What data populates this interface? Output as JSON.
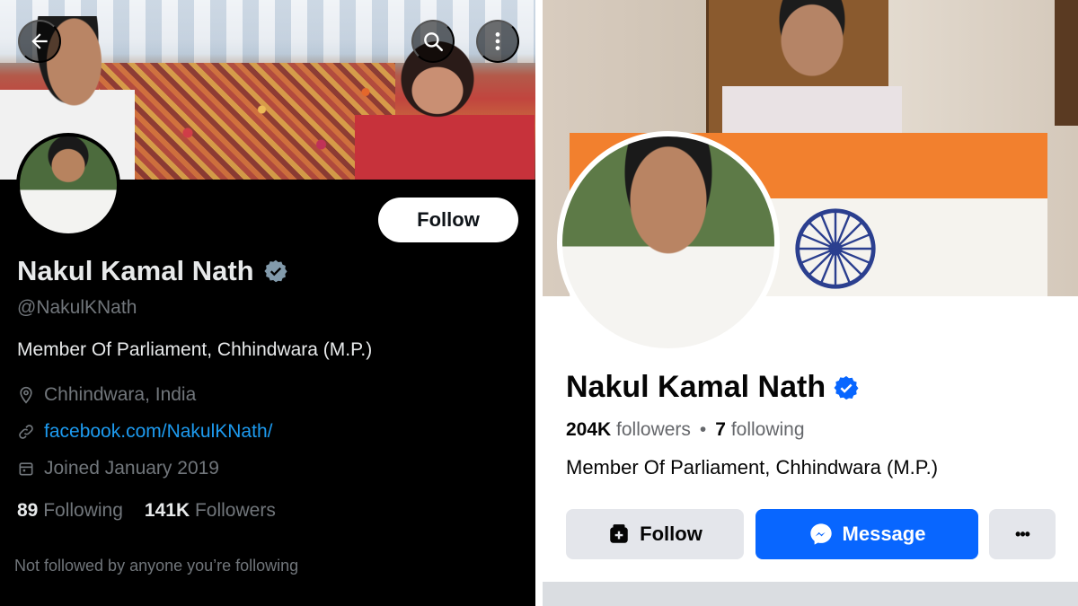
{
  "twitter": {
    "name": "Nakul Kamal Nath",
    "handle": "@NakulKNath",
    "bio": "Member Of Parliament, Chhindwara (M.P.)",
    "location": "Chhindwara, India",
    "link": "facebook.com/NakulKNath/",
    "joined": "Joined January 2019",
    "following_count": "89",
    "following_label": "Following",
    "followers_count": "141K",
    "followers_label": "Followers",
    "follow_button": "Follow",
    "note": "Not followed by anyone you’re following",
    "icons": [
      "back-arrow-icon",
      "search-icon",
      "more-vertical-icon",
      "verified-badge-icon",
      "location-pin-icon",
      "link-icon",
      "calendar-icon"
    ],
    "colors": {
      "background": "#000000",
      "text": "#e7e9ea",
      "muted": "#71767b",
      "link": "#1d9bf0",
      "verified": "#829aab"
    }
  },
  "facebook": {
    "name": "Nakul Kamal Nath",
    "followers_count": "204K",
    "followers_label": "followers",
    "separator": "•",
    "following_count": "7",
    "following_label": "following",
    "bio": "Member Of Parliament, Chhindwara (M.P.)",
    "follow_button": "Follow",
    "message_button": "Message",
    "more_button": "•••",
    "icons": [
      "verified-badge-icon",
      "follow-user-icon",
      "messenger-icon",
      "more-horizontal-icon"
    ],
    "colors": {
      "primary": "#0866ff",
      "secondary_button": "#e4e6eb",
      "text": "#050505",
      "muted": "#65676b"
    }
  }
}
